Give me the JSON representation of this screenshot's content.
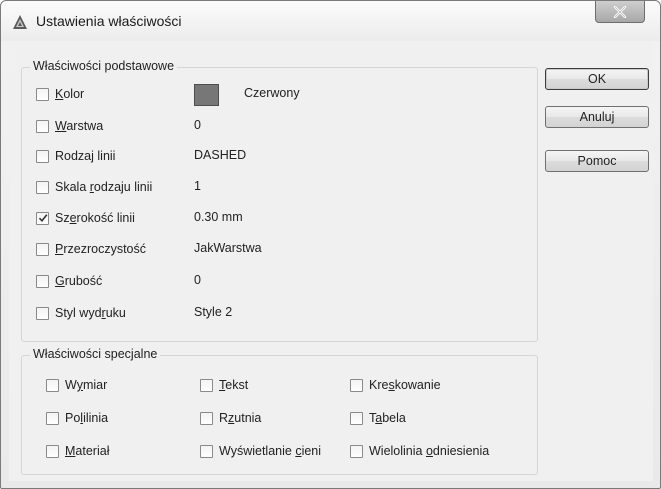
{
  "window": {
    "title": "Ustawienia właściwości",
    "close_icon": "close-x-icon",
    "app_icon": "autocad-a-icon"
  },
  "basic": {
    "title": "Właściwości podstawowe",
    "items": [
      {
        "pre": "",
        "u": "K",
        "post": "olor",
        "checked": false,
        "value": "Czerwony",
        "swatch": "#777777"
      },
      {
        "pre": "",
        "u": "W",
        "post": "arstwa",
        "checked": false,
        "value": "0"
      },
      {
        "pre": "Rodza",
        "u": "j",
        "post": " linii",
        "checked": false,
        "value": "DASHED"
      },
      {
        "pre": "Skala ",
        "u": "r",
        "post": "odzaju linii",
        "checked": false,
        "value": "1"
      },
      {
        "pre": "Sz",
        "u": "e",
        "post": "rokość linii",
        "checked": true,
        "value": "0.30 mm"
      },
      {
        "pre": "",
        "u": "P",
        "post": "rzezroczystość",
        "checked": false,
        "value": "JakWarstwa"
      },
      {
        "pre": "",
        "u": "G",
        "post": "rubość",
        "checked": false,
        "value": "0"
      },
      {
        "pre": "Styl wyd",
        "u": "r",
        "post": "uku",
        "checked": false,
        "value": "Style 2"
      }
    ]
  },
  "special": {
    "title": "Właściwości specjalne",
    "items": [
      {
        "pre": "W",
        "u": "y",
        "post": "miar",
        "checked": false
      },
      {
        "pre": "",
        "u": "T",
        "post": "ekst",
        "checked": false
      },
      {
        "pre": "Kre",
        "u": "s",
        "post": "kowanie",
        "checked": false
      },
      {
        "pre": "Po",
        "u": "l",
        "post": "ilinia",
        "checked": false
      },
      {
        "pre": "R",
        "u": "z",
        "post": "utnia",
        "checked": false
      },
      {
        "pre": "T",
        "u": "a",
        "post": "bela",
        "checked": false
      },
      {
        "pre": "",
        "u": "M",
        "post": "ateriał",
        "checked": false
      },
      {
        "pre": "Wyświetlanie ",
        "u": "c",
        "post": "ieni",
        "checked": false
      },
      {
        "pre": "Wielolinia ",
        "u": "o",
        "post": "dniesienia",
        "checked": false
      }
    ]
  },
  "buttons": {
    "ok": "OK",
    "cancel": "Anuluj",
    "help": "Pomoc"
  }
}
